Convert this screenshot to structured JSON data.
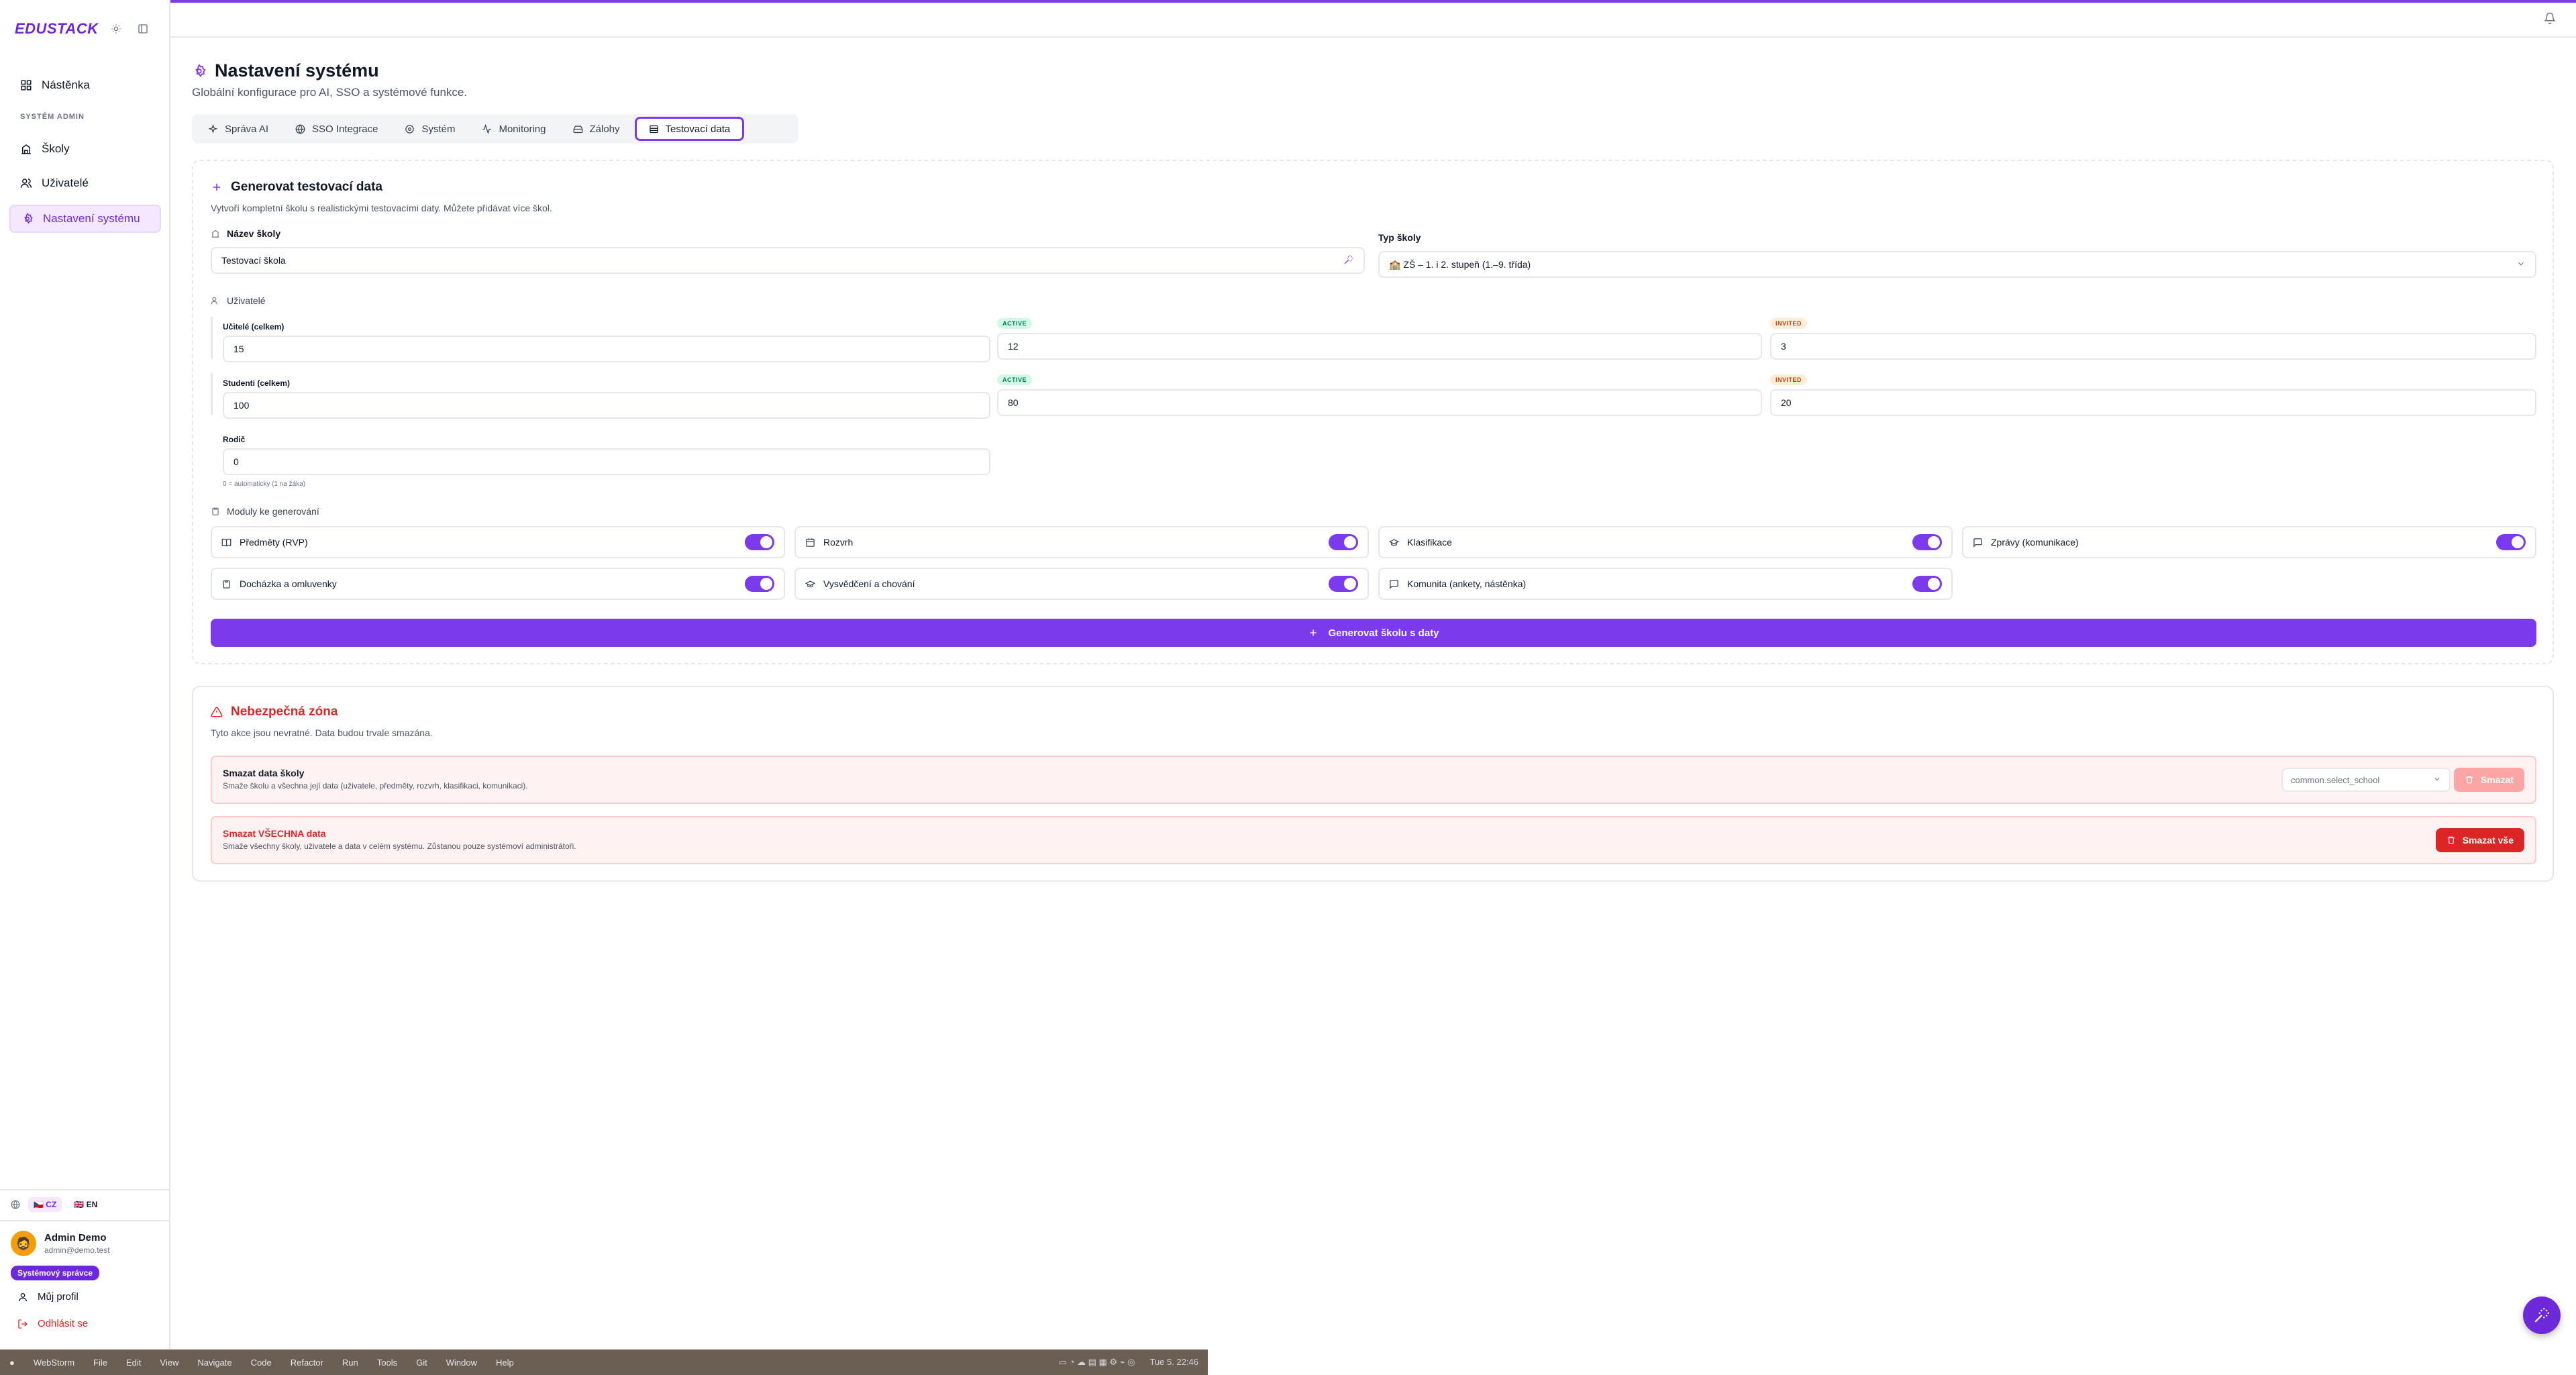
{
  "brand": "EDUSTACK",
  "sidebar": {
    "items": [
      {
        "label": "Nástěnka"
      },
      {
        "label": "Školy"
      },
      {
        "label": "Uživatelé"
      },
      {
        "label": "Nastavení systému"
      }
    ],
    "section_label": "SYSTÉM ADMIN",
    "languages": [
      {
        "label": "CZ"
      },
      {
        "label": "EN"
      }
    ],
    "user": {
      "name": "Admin Demo",
      "email": "admin@demo.test",
      "role": "Systémový správce"
    },
    "profile_label": "Můj profil",
    "logout_label": "Odhlásit se"
  },
  "page": {
    "title": "Nastavení systému",
    "subtitle": "Globální konfigurace pro AI, SSO a systémové funkce."
  },
  "tabs": [
    {
      "label": "Správa AI"
    },
    {
      "label": "SSO Integrace"
    },
    {
      "label": "Systém"
    },
    {
      "label": "Monitoring"
    },
    {
      "label": "Zálohy"
    },
    {
      "label": "Testovací data"
    }
  ],
  "generate": {
    "title": "Generovat testovací data",
    "subtitle": "Vytvoří kompletní školu s realistickými testovacími daty. Můžete přidávat více škol.",
    "school_name_label": "Název školy",
    "school_name_value": "Testovací škola",
    "school_type_label": "Typ školy",
    "school_type_value": "🏫 ZŠ – 1. i 2. stupeň (1.–9. třída)",
    "users_label": "Uživatelé",
    "teachers_label": "Učitelé (celkem)",
    "teachers_total": "15",
    "teachers_active": "12",
    "teachers_invited": "3",
    "students_label": "Studenti (celkem)",
    "students_total": "100",
    "students_active": "80",
    "students_invited": "20",
    "parents_label": "Rodič",
    "parents_value": "0",
    "parents_hint": "0 = automaticky (1 na žáka)",
    "badge_active": "ACTIVE",
    "badge_invited": "INVITED",
    "modules_label": "Moduly ke generování",
    "modules": [
      {
        "label": "Předměty (RVP)",
        "enabled": true
      },
      {
        "label": "Rozvrh",
        "enabled": true
      },
      {
        "label": "Klasifikace",
        "enabled": true
      },
      {
        "label": "Zprávy (komunikace)",
        "enabled": true
      },
      {
        "label": "Docházka a omluvenky",
        "enabled": true
      },
      {
        "label": "Vysvědčení a chování",
        "enabled": true
      },
      {
        "label": "Komunita (ankety, nástěnka)",
        "enabled": true
      }
    ],
    "button_label": "Generovat školu s daty"
  },
  "danger": {
    "title": "Nebezpečná zóna",
    "subtitle": "Tyto akce jsou nevratné. Data budou trvale smazána.",
    "school_title": "Smazat data školy",
    "school_sub": "Smaže školu a všechna její data (uživatele, předměty, rozvrh, klasifikaci, komunikaci).",
    "school_select": "common.select_school",
    "school_button": "Smazat",
    "all_title": "Smazat VŠECHNA data",
    "all_sub": "Smaže všechny školy, uživatele a data v celém systému. Zůstanou pouze systémoví administrátoři.",
    "all_button": "Smazat vše"
  },
  "colors": {
    "accent": "#7c3aed",
    "danger": "#dc2626",
    "danger_light": "#fca5a5"
  },
  "osbar": {
    "items": [
      "WebStorm",
      "File",
      "Edit",
      "View",
      "Navigate",
      "Code",
      "Refactor",
      "Run",
      "Tools",
      "Git",
      "Window",
      "Help"
    ],
    "clock": "Tue 5. 22:46"
  }
}
